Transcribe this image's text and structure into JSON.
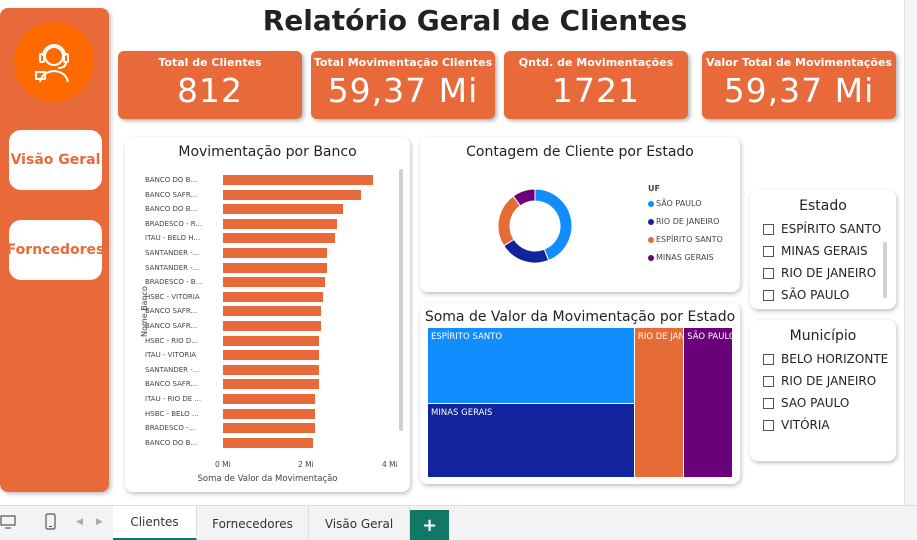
{
  "title": "Relatório Geral de Clientes",
  "sidebar": {
    "buttons": [
      "Visão Geral",
      "Forncedores"
    ]
  },
  "kpis": [
    {
      "label": "Total de Clientes",
      "value": "812"
    },
    {
      "label": "Total Movimentação Clientes",
      "value": "59,37 Mi"
    },
    {
      "label": "Qntd. de Movimentações",
      "value": "1721"
    },
    {
      "label": "Valor Total de Movimentações",
      "value": "59,37 Mi"
    }
  ],
  "bar_chart": {
    "title": "Movimentação por Banco",
    "ylabel": "Nome Banco",
    "xlabel": "Soma de Valor da Movimentação",
    "ticks": [
      "0 Mi",
      "2 Mi",
      "4 Mi"
    ]
  },
  "donut": {
    "title": "Contagem de Cliente por Estado",
    "legend_title": "UF"
  },
  "treemap": {
    "title": "Soma de Valor da Movimentação por Estado"
  },
  "slicer_estado": {
    "title": "Estado",
    "items": [
      "ESPÍRITO SANTO",
      "MINAS GERAIS",
      "RIO DE JANEIRO",
      "SÃO PAULO"
    ]
  },
  "slicer_municipio": {
    "title": "Município",
    "items": [
      "BELO HORIZONTE",
      "RIO DE JANEIRO",
      "SAO PAULO",
      "VITÓRIA"
    ]
  },
  "tabs": [
    "Clientes",
    "Fornecedores",
    "Visão Geral"
  ],
  "tab_add": "+",
  "colors": {
    "accent": "#e8693a",
    "sp": "#118dff",
    "rj": "#12239e",
    "es": "#e66c37",
    "mg": "#6b007b"
  },
  "chart_data": [
    {
      "type": "bar",
      "title": "Movimentação por Banco",
      "xlabel": "Soma de Valor da Movimentação",
      "ylabel": "Nome Banco",
      "xlim": [
        0,
        4
      ],
      "unit": "Mi",
      "categories": [
        "BANCO DO B...",
        "BANCO SAFR...",
        "BANCO DO B...",
        "BRADESCO - R...",
        "ITAÚ - BELO H...",
        "SANTANDER -...",
        "SANTANDER -...",
        "BRADESCO - B...",
        "HSBC - VITÓRIA",
        "BANCO SAFR...",
        "BANCO SAFR...",
        "HSBC - RIO D...",
        "ITAÚ - VITÓRIA",
        "SANTANDER -...",
        "BANCO SAFR...",
        "ITAÚ - RIO DE ...",
        "HSBC - BELO ...",
        "BRADESCO -...",
        "BANCO DO B..."
      ],
      "values": [
        3.75,
        3.45,
        3.0,
        2.85,
        2.8,
        2.6,
        2.6,
        2.55,
        2.5,
        2.45,
        2.45,
        2.4,
        2.4,
        2.4,
        2.4,
        2.3,
        2.3,
        2.3,
        2.25
      ]
    },
    {
      "type": "pie",
      "title": "Contagem de Cliente por Estado",
      "legend": "UF",
      "categories": [
        "SÃO PAULO",
        "RIO DE JANEIRO",
        "ESPÍRITO SANTO",
        "MINAS GERAIS"
      ],
      "values": [
        44,
        22,
        24,
        10
      ]
    },
    {
      "type": "treemap",
      "title": "Soma de Valor da Movimentação por Estado",
      "categories": [
        "ESPÍRITO SANTO",
        "MINAS GERAIS",
        "RIO DE JANEIRO",
        "SÃO PAULO"
      ],
      "values": [
        20.5,
        19.8,
        9.6,
        9.5
      ]
    }
  ]
}
